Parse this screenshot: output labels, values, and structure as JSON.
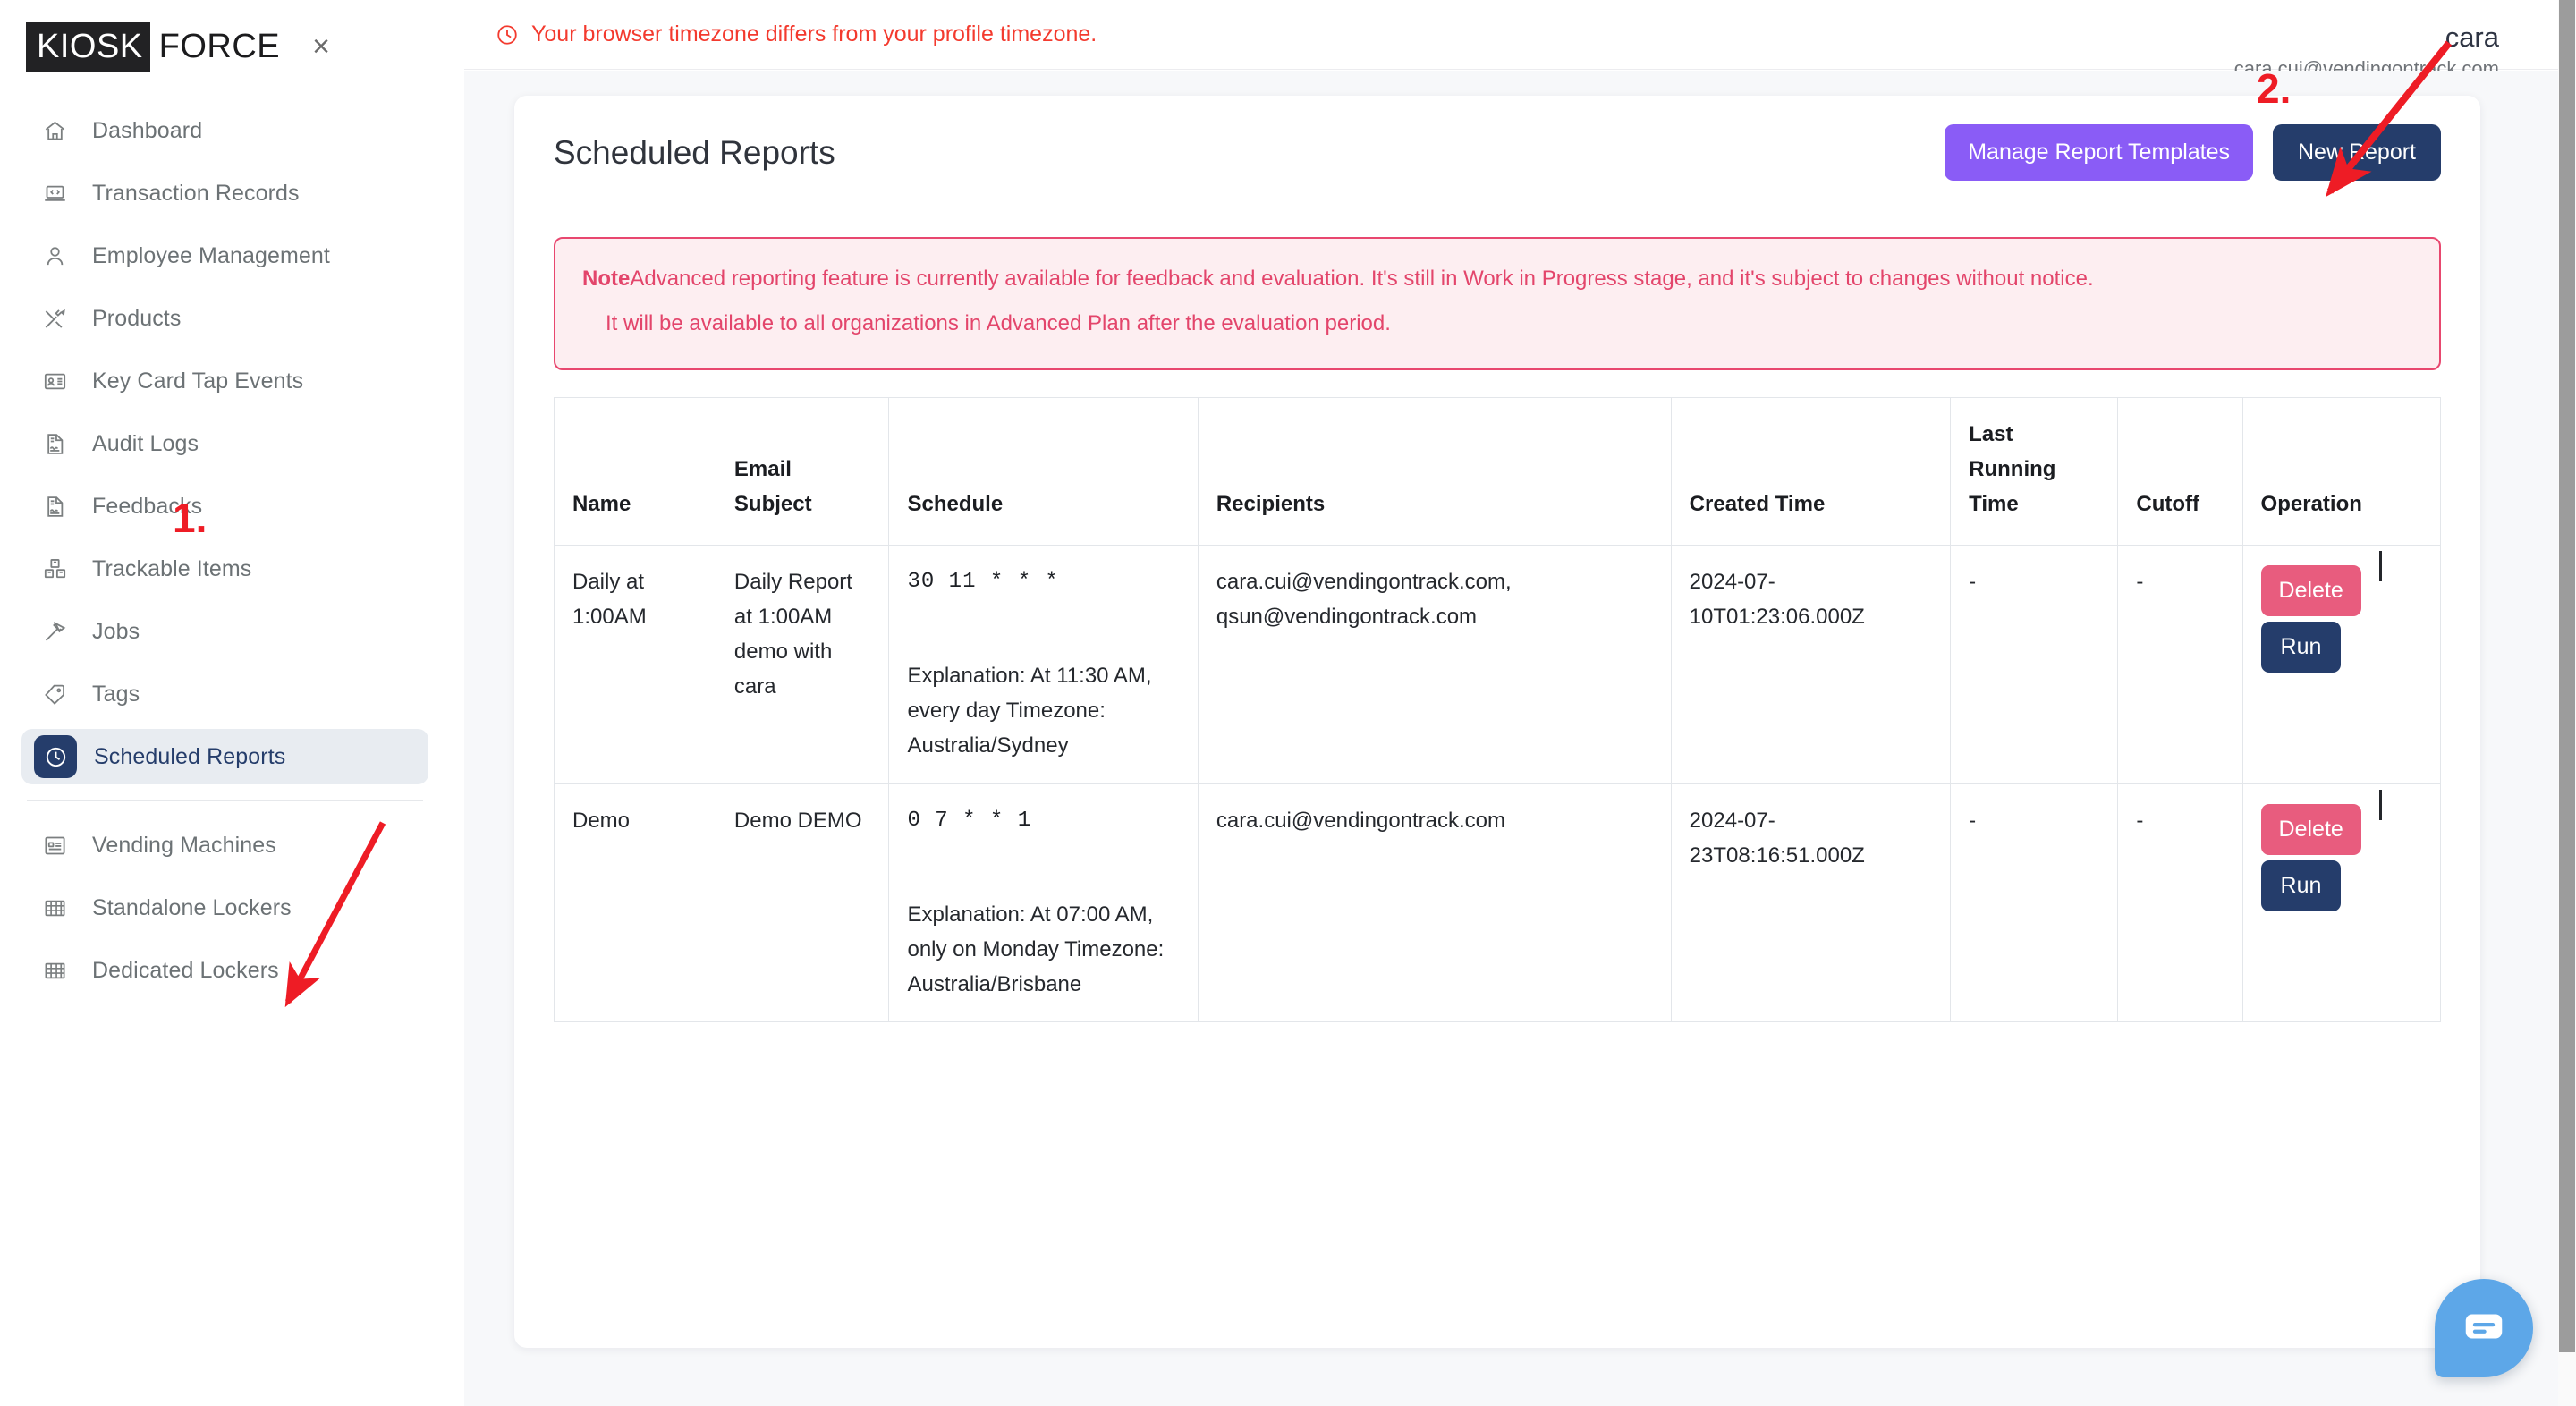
{
  "brand": {
    "primary": "KIOSK",
    "secondary": "FORCE",
    "close": "×"
  },
  "topbar": {
    "timezone_warning": "Your browser timezone differs from your profile timezone.",
    "user_name": "cara",
    "user_email": "cara.cui@vendingontrack.com"
  },
  "sidebar": {
    "items": [
      {
        "label": "Dashboard",
        "icon": "home-icon",
        "active": false
      },
      {
        "label": "Transaction Records",
        "icon": "laptop-code-icon",
        "active": false
      },
      {
        "label": "Employee Management",
        "icon": "user-icon",
        "active": false
      },
      {
        "label": "Products",
        "icon": "tools-icon",
        "active": false
      },
      {
        "label": "Key Card Tap Events",
        "icon": "id-card-icon",
        "active": false
      },
      {
        "label": "Audit Logs",
        "icon": "document-signature-icon",
        "active": false
      },
      {
        "label": "Feedbacks",
        "icon": "document-signature-icon",
        "active": false
      },
      {
        "label": "Trackable Items",
        "icon": "boxes-icon",
        "active": false
      },
      {
        "label": "Jobs",
        "icon": "hammer-icon",
        "active": false
      },
      {
        "label": "Tags",
        "icon": "tag-icon",
        "active": false
      },
      {
        "label": "Scheduled Reports",
        "icon": "clock-icon",
        "active": true
      }
    ],
    "items_after_divider": [
      {
        "label": "Vending Machines",
        "icon": "vending-machine-icon"
      },
      {
        "label": "Standalone Lockers",
        "icon": "grid-icon"
      },
      {
        "label": "Dedicated Lockers",
        "icon": "grid-icon"
      }
    ]
  },
  "page": {
    "title": "Scheduled Reports",
    "manage_templates_label": "Manage Report Templates",
    "new_report_label": "New Report",
    "note_bold": "Note",
    "note_line1": "Advanced reporting feature is currently available for feedback and evaluation. It's still in Work in Progress stage, and it's subject to changes without notice.",
    "note_line2": "It will be available to all organizations in Advanced Plan after the evaluation period."
  },
  "table": {
    "headers": [
      "Name",
      "Email Subject",
      "Schedule",
      "Recipients",
      "Created Time",
      "Last Running Time",
      "Cutoff",
      "Operation"
    ],
    "rows": [
      {
        "name": "Daily at 1:00AM",
        "email_subject": "Daily Report at 1:00AM demo with cara",
        "cron": "30 11 * * *",
        "explanation": "Explanation: At 11:30 AM, every day Timezone: Australia/Sydney",
        "recipients": "cara.cui@vendingontrack.com, qsun@vendingontrack.com",
        "created_time": "2024-07-10T01:23:06.000Z",
        "last_running_time": "-",
        "cutoff": "-",
        "delete_label": "Delete",
        "run_label": "Run"
      },
      {
        "name": "Demo",
        "email_subject": "Demo DEMO",
        "cron": "0 7 * * 1",
        "explanation": "Explanation: At 07:00 AM, only on Monday Timezone: Australia/Brisbane",
        "recipients": "cara.cui@vendingontrack.com",
        "created_time": "2024-07-23T08:16:51.000Z",
        "last_running_time": "-",
        "cutoff": "-",
        "delete_label": "Delete",
        "run_label": "Run"
      }
    ]
  },
  "annotations": {
    "step1": "1.",
    "step2": "2.",
    "color": "#ee1c25"
  },
  "colors": {
    "navy": "#253D6B",
    "purple": "#8a5cf6",
    "delete_pink": "#e85c7e",
    "warning_red": "#f33a2e",
    "note_bg": "#fdeef1",
    "note_border": "#e8476f",
    "chat_blue": "#5da7e8"
  },
  "chat": {
    "icon": "chat-bubble-icon"
  }
}
